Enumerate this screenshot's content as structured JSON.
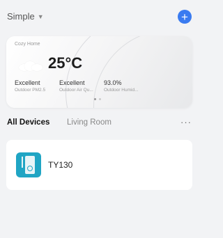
{
  "header": {
    "home_selector": "Simple",
    "add_button": "+"
  },
  "weather": {
    "home_name": "Cozy Home",
    "temperature": "25°C",
    "metrics": [
      {
        "value": "Excellent",
        "label": "Outdoor PM2.5"
      },
      {
        "value": "Excellent",
        "label": "Outdoor Air Qu..."
      },
      {
        "value": "93.0%",
        "label": "Outdoor Humid..."
      }
    ]
  },
  "tabs": {
    "items": [
      "All Devices",
      "Living Room"
    ],
    "more": "···"
  },
  "devices": [
    {
      "name": "TY130",
      "icon": "smart-plug-icon"
    }
  ],
  "colors": {
    "accent": "#3a7bf0",
    "device_icon_bg": "#20a5c4"
  }
}
